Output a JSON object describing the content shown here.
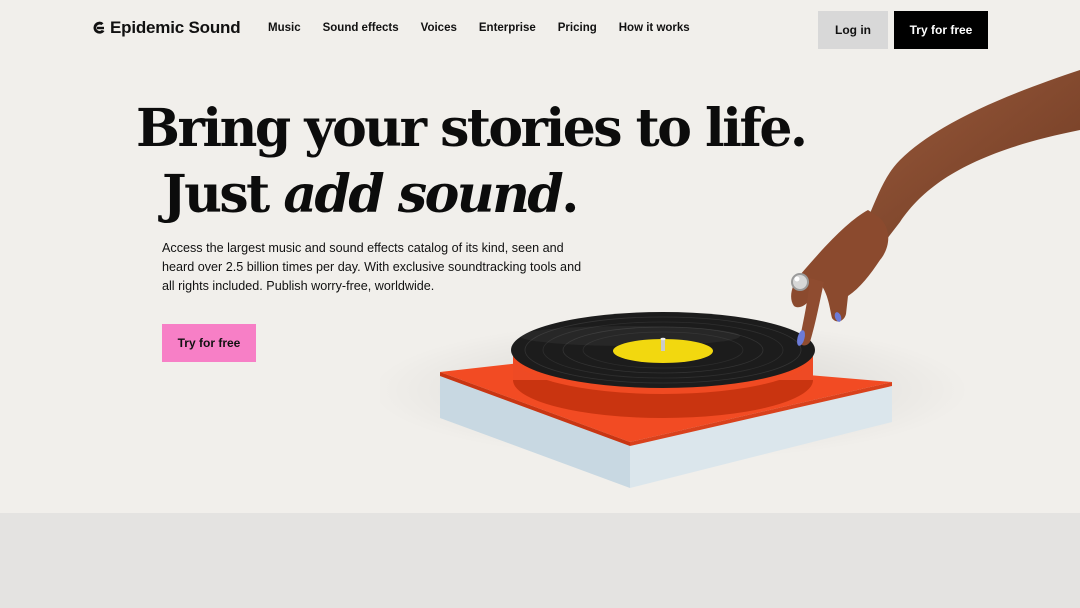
{
  "brand": {
    "name": "Epidemic Sound",
    "icon": "epidemic-logo-icon"
  },
  "nav": {
    "items": [
      {
        "label": "Music"
      },
      {
        "label": "Sound effects"
      },
      {
        "label": "Voices"
      },
      {
        "label": "Enterprise"
      },
      {
        "label": "Pricing"
      },
      {
        "label": "How it works"
      }
    ]
  },
  "header": {
    "login_label": "Log in",
    "try_label": "Try for free"
  },
  "hero": {
    "headline_line1": "Bring your stories to life.",
    "headline_line2_plain": "Just ",
    "headline_line2_italic": "add sound",
    "headline_line2_end": ".",
    "subtext": "Access the largest music and sound effects catalog of its kind, seen and heard over 2.5 billion times per day. With exclusive soundtracking tools and all rights included. Publish worry-free, worldwide.",
    "cta_label": "Try for free"
  },
  "colors": {
    "background": "#f1efeb",
    "cta_pink": "#f77fc6",
    "header_cta": "#000000",
    "login_bg": "#d8d8d8",
    "turntable_orange": "#f04a22",
    "label_yellow": "#f2d80f"
  }
}
